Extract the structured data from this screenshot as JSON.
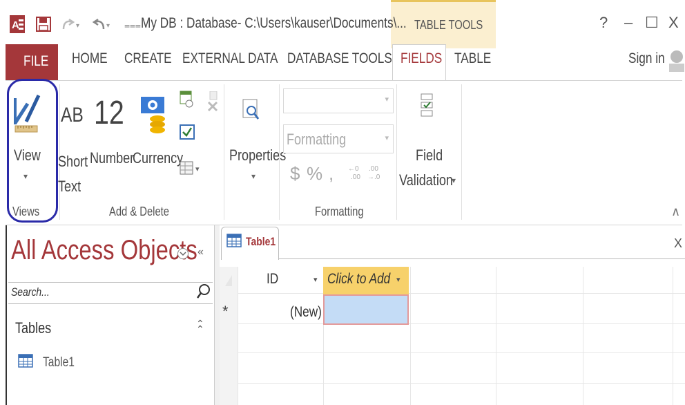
{
  "window": {
    "title": "My DB : Database- C:\\Users\\kauser\\Documents\\...",
    "contextual_tab_group": "TABLE TOOLS",
    "help": "?",
    "minimize": "–",
    "maximize": "☐",
    "close": "X",
    "sign_in": "Sign in"
  },
  "ribbon_tabs": {
    "file": "FILE",
    "home": "HOME",
    "create": "CREATE",
    "external_data": "EXTERNAL DATA",
    "database_tools": "DATABASE TOOLS",
    "fields": "FIELDS",
    "table": "TABLE"
  },
  "ribbon": {
    "views": {
      "view_label": "View",
      "dropdown": "▾",
      "group_label": "Views"
    },
    "add_delete": {
      "short_text_line1": "Short",
      "short_text_line2": "Text",
      "short_text_icon": "AB",
      "number_label": "Number",
      "number_icon": "12",
      "currency_label": "Currency",
      "group_label": "Add & Delete"
    },
    "properties": {
      "label": "Properties",
      "dropdown": "▾"
    },
    "formatting": {
      "format_placeholder": "Formatting",
      "currency_symbol": "$",
      "percent_symbol": "%",
      "comma_symbol": ",",
      "group_label": "Formatting"
    },
    "field_validation": {
      "line1": "Field",
      "line2": "Validation",
      "dropdown": "▾"
    },
    "collapse": "∧"
  },
  "nav_pane": {
    "title": "All Access Objects",
    "search_placeholder": "Search...",
    "section": "Tables",
    "items": [
      "Table1"
    ]
  },
  "document": {
    "tab_label": "Table1",
    "close": "X",
    "columns": [
      "ID",
      "Click to Add"
    ],
    "new_row_marker": "*",
    "new_row_id": "(New)"
  },
  "colors": {
    "file_tab": "#a4373a",
    "contextual_band": "#fbefd0",
    "click_to_add_header": "#f7d16b",
    "selected_cell": "#c4dcf6",
    "views_highlight": "#2a2aa8"
  }
}
